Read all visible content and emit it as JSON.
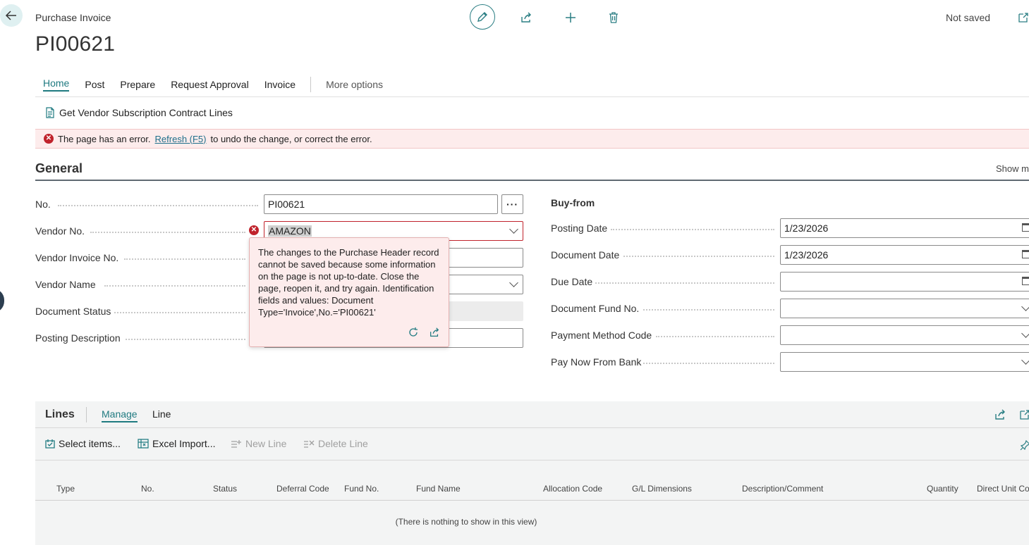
{
  "header": {
    "page_type": "Purchase Invoice",
    "title": "PI00621",
    "status": "Not saved"
  },
  "tabs": [
    {
      "label": "Home",
      "active": true
    },
    {
      "label": "Post"
    },
    {
      "label": "Prepare"
    },
    {
      "label": "Request Approval"
    },
    {
      "label": "Invoice"
    }
  ],
  "more_options": "More options",
  "actions": {
    "get_vendor_lines": "Get Vendor Subscription Contract Lines"
  },
  "error_bar": {
    "before": "The page has an error.",
    "link": "Refresh (F5)",
    "after": "to undo the change, or correct the error."
  },
  "general": {
    "title": "General",
    "show_more": "Show mo",
    "fields": {
      "no": {
        "label": "No.",
        "value": "PI00621"
      },
      "vendor_no": {
        "label": "Vendor No.",
        "value": "AMAZON"
      },
      "vendor_invoice_no": {
        "label": "Vendor Invoice No.",
        "value": ""
      },
      "vendor_name": {
        "label": "Vendor Name",
        "value": ""
      },
      "document_status": {
        "label": "Document Status",
        "value": ""
      },
      "posting_description": {
        "label": "Posting Description",
        "value": ""
      }
    },
    "buy_from": {
      "title": "Buy-from",
      "posting_date": {
        "label": "Posting Date",
        "value": "1/23/2026"
      },
      "document_date": {
        "label": "Document Date",
        "value": "1/23/2026"
      },
      "due_date": {
        "label": "Due Date",
        "value": ""
      },
      "document_fund_no": {
        "label": "Document Fund No.",
        "value": ""
      },
      "payment_method_code": {
        "label": "Payment Method Code",
        "value": ""
      },
      "pay_now_from_bank": {
        "label": "Pay Now From Bank",
        "value": ""
      }
    }
  },
  "tooltip": {
    "message": "The changes to the Purchase Header record cannot be saved because some information on the page is not up-to-date. Close the page, reopen it, and try again. Identification fields and values: Document Type='Invoice',No.='PI00621'"
  },
  "lines": {
    "title": "Lines",
    "tabs": [
      "Manage",
      "Line"
    ],
    "actions": {
      "select_items": "Select items...",
      "excel_import": "Excel Import...",
      "new_line": "New Line",
      "delete_line": "Delete Line"
    },
    "columns": [
      "Type",
      "No.",
      "Status",
      "Deferral Code",
      "Fund No.",
      "Fund Name",
      "Allocation Code",
      "G/L Dimensions",
      "Description/Comment",
      "Quantity",
      "Direct Unit Co"
    ],
    "empty": "(There is nothing to show in this view)"
  },
  "colors": {
    "accent": "#1f7a80",
    "error": "#c0232c",
    "error_bg": "#fdecec"
  }
}
